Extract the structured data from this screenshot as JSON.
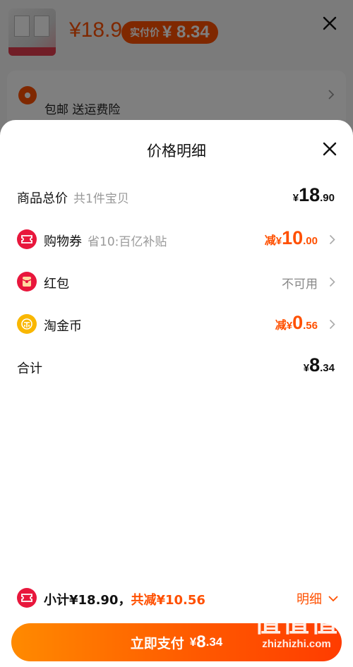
{
  "background": {
    "price": "¥18.9",
    "badge_label": "实付价",
    "badge_value": "¥ 8.34",
    "shipping": "包邮  送运费险"
  },
  "sheet": {
    "title": "价格明细",
    "rows": [
      {
        "label": "商品总价",
        "sub": "共1件宝贝",
        "symbol": "¥",
        "int": "18",
        "dec": ".90"
      },
      {
        "label": "购物券",
        "sub": "省10:百亿补贴",
        "prefix": "减",
        "symbol": "¥",
        "int": "10",
        "dec": ".00",
        "icon": "coupon-icon"
      },
      {
        "label": "红包",
        "status": "不可用",
        "icon": "red-packet-icon"
      },
      {
        "label": "淘金币",
        "prefix": "减",
        "symbol": "¥",
        "int": "0",
        "dec": ".56",
        "icon": "gold-coin-icon"
      },
      {
        "label": "合计",
        "symbol": "¥",
        "int": "8",
        "dec": ".34"
      }
    ]
  },
  "footer": {
    "subtotal": "小计¥18.90，",
    "discount": "共减¥10.56",
    "detail": "明细",
    "pay_label": "立即支付",
    "pay_symbol": "¥",
    "pay_int": "8",
    "pay_dec": ".34"
  },
  "watermark": {
    "glyphs": "值值值",
    "text": "zhizhizhi.com"
  },
  "colors": {
    "accent": "#ff5000",
    "coupon_red": "#e8173c",
    "coin_gold": "#f9b700"
  }
}
